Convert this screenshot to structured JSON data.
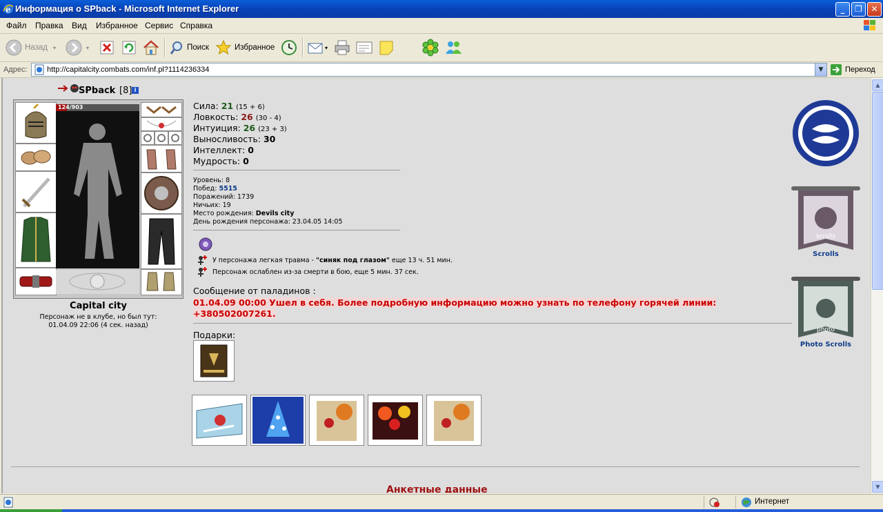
{
  "window": {
    "title": "Информация о SPback - Microsoft Internet Explorer"
  },
  "menu": [
    "Файл",
    "Правка",
    "Вид",
    "Избранное",
    "Сервис",
    "Справка"
  ],
  "toolbar": {
    "back": "Назад",
    "search": "Поиск",
    "favorites": "Избранное"
  },
  "address": {
    "label": "Адрес:",
    "url": "http://capitalcity.combats.com/inf.pl?1114236334",
    "go": "Переход"
  },
  "character": {
    "name": "SPback",
    "level": "[8]",
    "hp": "124/903",
    "city": "Capital city",
    "online_note": "Персонаж не в клубе, но был тут:",
    "last_seen": "01.04.09 22:06 (4 сек. назад)"
  },
  "stats": [
    {
      "label": "Сила:",
      "value": "21",
      "detail": "(15 + 6)",
      "color": "#1d5a1d"
    },
    {
      "label": "Ловкость:",
      "value": "26",
      "detail": "(30 - 4)",
      "color": "#8b1a1a"
    },
    {
      "label": "Интуиция:",
      "value": "26",
      "detail": "(23 + 3)",
      "color": "#1d5a1d"
    },
    {
      "label": "Выносливость:",
      "value": "30",
      "detail": "",
      "color": "#000000"
    },
    {
      "label": "Интеллект:",
      "value": "0",
      "detail": "",
      "color": "#000000"
    },
    {
      "label": "Мудрость:",
      "value": "0",
      "detail": "",
      "color": "#000000"
    }
  ],
  "info": {
    "level_label": "Уровень:",
    "level_value": "8",
    "wins_label": "Побед:",
    "wins_value": "5515",
    "losses_label": "Поражений:",
    "losses_value": "1739",
    "draws_label": "Ничьих:",
    "draws_value": "19",
    "birthplace_label": "Место рождения:",
    "birthplace_value": "Devils city",
    "birthday_label": "День рождения персонажа:",
    "birthday_value": "23.04.05 14:05"
  },
  "effects": {
    "injury_pre": "У персонажа легкая травма - ",
    "injury_name": "\"синяк под глазом\"",
    "injury_post": " еще 13 ч. 51 мин.",
    "weak": "Персонаж ослаблен из-за смерти в бою, еще 5 мин. 37 сек."
  },
  "paladin": {
    "header": "Сообщение от паладинов :",
    "line1": "01.04.09 00:00 Ушел в себя. Более подробную информацию можно узнать по телефону горячей линии:",
    "line2": "+380502007261."
  },
  "gifts": {
    "label": "Подарки:"
  },
  "right": {
    "scrolls": "Scrolls",
    "photo_scrolls": "Photo Scrolls",
    "banner1_text": "scrolls",
    "banner2_text": "photo"
  },
  "bottom": {
    "partial_title": "Анкетные данные"
  },
  "status": {
    "zone": "Интернет"
  },
  "colors": {
    "accent_red": "#cc0000",
    "link_blue": "#0f3b8a",
    "win_blue": "#0842b8"
  }
}
